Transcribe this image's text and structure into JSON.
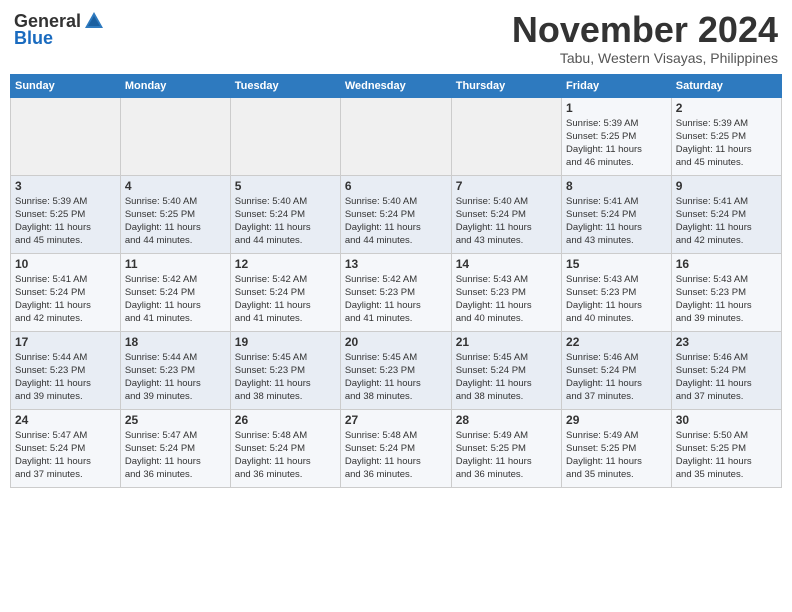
{
  "header": {
    "logo_general": "General",
    "logo_blue": "Blue",
    "month": "November 2024",
    "location": "Tabu, Western Visayas, Philippines"
  },
  "weekdays": [
    "Sunday",
    "Monday",
    "Tuesday",
    "Wednesday",
    "Thursday",
    "Friday",
    "Saturday"
  ],
  "weeks": [
    [
      {
        "day": "",
        "info": ""
      },
      {
        "day": "",
        "info": ""
      },
      {
        "day": "",
        "info": ""
      },
      {
        "day": "",
        "info": ""
      },
      {
        "day": "",
        "info": ""
      },
      {
        "day": "1",
        "info": "Sunrise: 5:39 AM\nSunset: 5:25 PM\nDaylight: 11 hours\nand 46 minutes."
      },
      {
        "day": "2",
        "info": "Sunrise: 5:39 AM\nSunset: 5:25 PM\nDaylight: 11 hours\nand 45 minutes."
      }
    ],
    [
      {
        "day": "3",
        "info": "Sunrise: 5:39 AM\nSunset: 5:25 PM\nDaylight: 11 hours\nand 45 minutes."
      },
      {
        "day": "4",
        "info": "Sunrise: 5:40 AM\nSunset: 5:25 PM\nDaylight: 11 hours\nand 44 minutes."
      },
      {
        "day": "5",
        "info": "Sunrise: 5:40 AM\nSunset: 5:24 PM\nDaylight: 11 hours\nand 44 minutes."
      },
      {
        "day": "6",
        "info": "Sunrise: 5:40 AM\nSunset: 5:24 PM\nDaylight: 11 hours\nand 44 minutes."
      },
      {
        "day": "7",
        "info": "Sunrise: 5:40 AM\nSunset: 5:24 PM\nDaylight: 11 hours\nand 43 minutes."
      },
      {
        "day": "8",
        "info": "Sunrise: 5:41 AM\nSunset: 5:24 PM\nDaylight: 11 hours\nand 43 minutes."
      },
      {
        "day": "9",
        "info": "Sunrise: 5:41 AM\nSunset: 5:24 PM\nDaylight: 11 hours\nand 42 minutes."
      }
    ],
    [
      {
        "day": "10",
        "info": "Sunrise: 5:41 AM\nSunset: 5:24 PM\nDaylight: 11 hours\nand 42 minutes."
      },
      {
        "day": "11",
        "info": "Sunrise: 5:42 AM\nSunset: 5:24 PM\nDaylight: 11 hours\nand 41 minutes."
      },
      {
        "day": "12",
        "info": "Sunrise: 5:42 AM\nSunset: 5:24 PM\nDaylight: 11 hours\nand 41 minutes."
      },
      {
        "day": "13",
        "info": "Sunrise: 5:42 AM\nSunset: 5:23 PM\nDaylight: 11 hours\nand 41 minutes."
      },
      {
        "day": "14",
        "info": "Sunrise: 5:43 AM\nSunset: 5:23 PM\nDaylight: 11 hours\nand 40 minutes."
      },
      {
        "day": "15",
        "info": "Sunrise: 5:43 AM\nSunset: 5:23 PM\nDaylight: 11 hours\nand 40 minutes."
      },
      {
        "day": "16",
        "info": "Sunrise: 5:43 AM\nSunset: 5:23 PM\nDaylight: 11 hours\nand 39 minutes."
      }
    ],
    [
      {
        "day": "17",
        "info": "Sunrise: 5:44 AM\nSunset: 5:23 PM\nDaylight: 11 hours\nand 39 minutes."
      },
      {
        "day": "18",
        "info": "Sunrise: 5:44 AM\nSunset: 5:23 PM\nDaylight: 11 hours\nand 39 minutes."
      },
      {
        "day": "19",
        "info": "Sunrise: 5:45 AM\nSunset: 5:23 PM\nDaylight: 11 hours\nand 38 minutes."
      },
      {
        "day": "20",
        "info": "Sunrise: 5:45 AM\nSunset: 5:23 PM\nDaylight: 11 hours\nand 38 minutes."
      },
      {
        "day": "21",
        "info": "Sunrise: 5:45 AM\nSunset: 5:24 PM\nDaylight: 11 hours\nand 38 minutes."
      },
      {
        "day": "22",
        "info": "Sunrise: 5:46 AM\nSunset: 5:24 PM\nDaylight: 11 hours\nand 37 minutes."
      },
      {
        "day": "23",
        "info": "Sunrise: 5:46 AM\nSunset: 5:24 PM\nDaylight: 11 hours\nand 37 minutes."
      }
    ],
    [
      {
        "day": "24",
        "info": "Sunrise: 5:47 AM\nSunset: 5:24 PM\nDaylight: 11 hours\nand 37 minutes."
      },
      {
        "day": "25",
        "info": "Sunrise: 5:47 AM\nSunset: 5:24 PM\nDaylight: 11 hours\nand 36 minutes."
      },
      {
        "day": "26",
        "info": "Sunrise: 5:48 AM\nSunset: 5:24 PM\nDaylight: 11 hours\nand 36 minutes."
      },
      {
        "day": "27",
        "info": "Sunrise: 5:48 AM\nSunset: 5:24 PM\nDaylight: 11 hours\nand 36 minutes."
      },
      {
        "day": "28",
        "info": "Sunrise: 5:49 AM\nSunset: 5:25 PM\nDaylight: 11 hours\nand 36 minutes."
      },
      {
        "day": "29",
        "info": "Sunrise: 5:49 AM\nSunset: 5:25 PM\nDaylight: 11 hours\nand 35 minutes."
      },
      {
        "day": "30",
        "info": "Sunrise: 5:50 AM\nSunset: 5:25 PM\nDaylight: 11 hours\nand 35 minutes."
      }
    ]
  ]
}
